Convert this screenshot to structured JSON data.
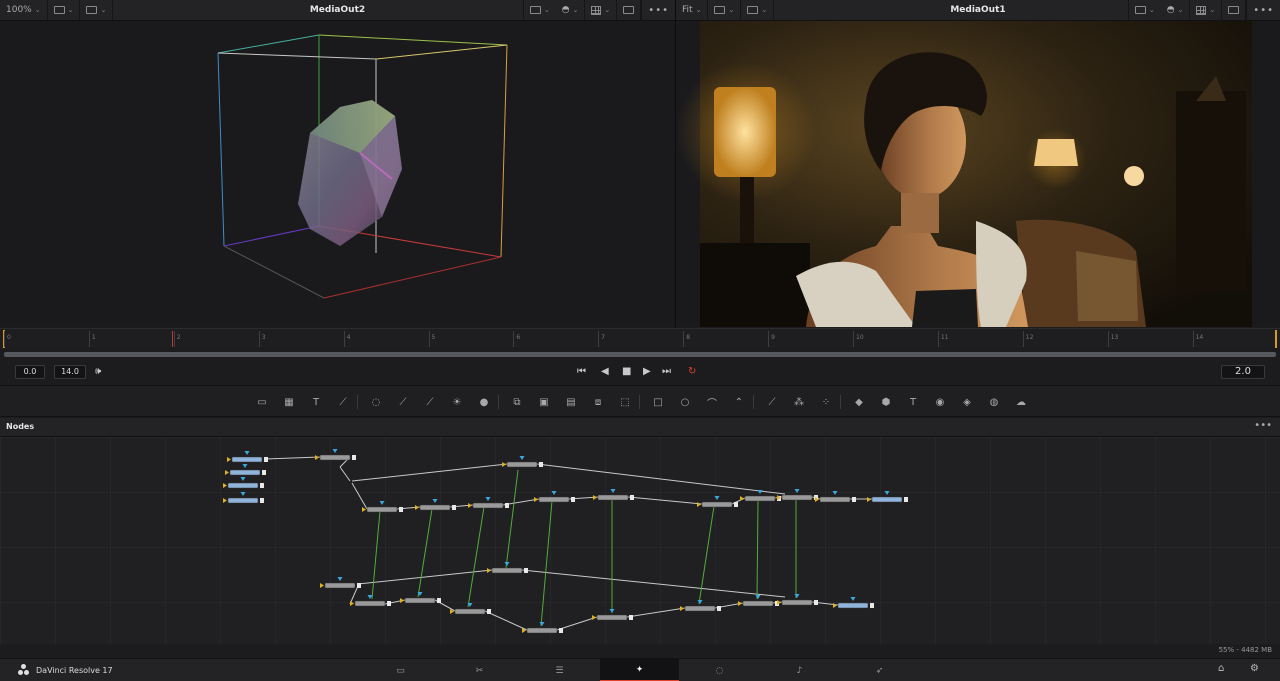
{
  "viewer_left": {
    "zoom": "100%",
    "title": "MediaOut2"
  },
  "viewer_right": {
    "zoom": "Fit",
    "title": "MediaOut1"
  },
  "ruler_labels": [
    "0",
    "1",
    "2",
    "3",
    "4",
    "5",
    "6",
    "7",
    "8",
    "9",
    "10",
    "11",
    "12",
    "13",
    "14"
  ],
  "transport": {
    "start": "0.0",
    "end": "14.0",
    "current": "2.0"
  },
  "nodes_panel": {
    "label": "Nodes",
    "memory": "55% - 4482 MB"
  },
  "app": {
    "name": "DaVinci Resolve 17"
  },
  "pages": [
    {
      "name": "media-page",
      "icon": "▭"
    },
    {
      "name": "cut-page",
      "icon": "✂"
    },
    {
      "name": "edit-page",
      "icon": "☰"
    },
    {
      "name": "fusion-page",
      "icon": "✦"
    },
    {
      "name": "color-page",
      "icon": "◌"
    },
    {
      "name": "fairlight-page",
      "icon": "♪"
    },
    {
      "name": "deliver-page",
      "icon": "➶"
    }
  ],
  "accent": "#e0412d",
  "node_color": "#9a9a9a",
  "node_blue": "#8fb3d9"
}
